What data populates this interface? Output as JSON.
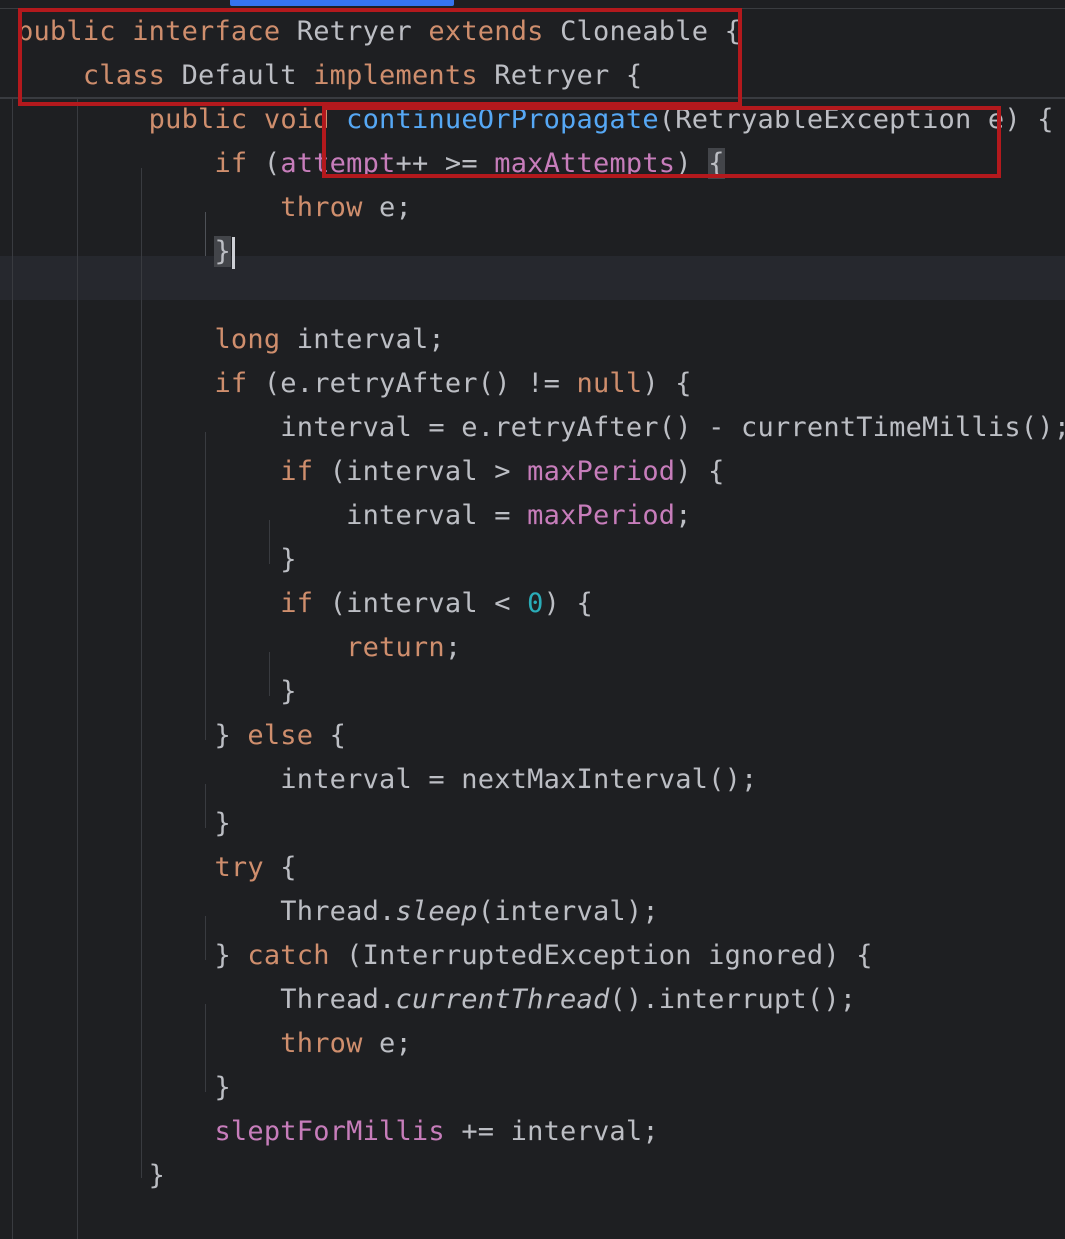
{
  "editor": {
    "language": "Java",
    "lines": [
      {
        "id": "l1",
        "text": "public interface Retryer extends Cloneable {",
        "tokens": [
          {
            "t": "public ",
            "c": "kw"
          },
          {
            "t": "interface ",
            "c": "kw"
          },
          {
            "t": "Retryer ",
            "c": ""
          },
          {
            "t": "extends ",
            "c": "kw"
          },
          {
            "t": "Cloneable {",
            "c": ""
          }
        ]
      },
      {
        "id": "l2",
        "text": "    class Default implements Retryer {",
        "tokens": [
          {
            "t": "    ",
            "c": ""
          },
          {
            "t": "class ",
            "c": "kw"
          },
          {
            "t": "Default ",
            "c": ""
          },
          {
            "t": "implements ",
            "c": "kw"
          },
          {
            "t": "Retryer {",
            "c": ""
          }
        ]
      },
      {
        "id": "l3",
        "text": "        public void continueOrPropagate(RetryableException e) {",
        "tokens": [
          {
            "t": "        ",
            "c": ""
          },
          {
            "t": "public ",
            "c": "kw"
          },
          {
            "t": "void ",
            "c": "kw"
          },
          {
            "t": "continueOrPropagate",
            "c": "fn"
          },
          {
            "t": "(RetryableException e) {",
            "c": ""
          }
        ]
      },
      {
        "id": "l4",
        "text": "            if (attempt++ >= maxAttempts) {",
        "tokens": [
          {
            "t": "            ",
            "c": ""
          },
          {
            "t": "if ",
            "c": "kw"
          },
          {
            "t": "(",
            "c": ""
          },
          {
            "t": "attempt",
            "c": "field"
          },
          {
            "t": "++ >= ",
            "c": ""
          },
          {
            "t": "maxAttempts",
            "c": "field"
          },
          {
            "t": ") ",
            "c": ""
          },
          {
            "t": "{",
            "c": "brace-match"
          }
        ]
      },
      {
        "id": "l5",
        "text": "                throw e;",
        "tokens": [
          {
            "t": "                ",
            "c": ""
          },
          {
            "t": "throw ",
            "c": "kw"
          },
          {
            "t": "e;",
            "c": ""
          }
        ]
      },
      {
        "id": "l6",
        "text": "            }",
        "tokens": [
          {
            "t": "            ",
            "c": ""
          },
          {
            "t": "}",
            "c": "brace-match"
          },
          {
            "t": "",
            "c": "caret"
          }
        ]
      },
      {
        "id": "l7",
        "text": "",
        "tokens": []
      },
      {
        "id": "l8",
        "text": "            long interval;",
        "tokens": [
          {
            "t": "            ",
            "c": ""
          },
          {
            "t": "long ",
            "c": "kw"
          },
          {
            "t": "interval;",
            "c": ""
          }
        ]
      },
      {
        "id": "l9",
        "text": "            if (e.retryAfter() != null) {",
        "tokens": [
          {
            "t": "            ",
            "c": ""
          },
          {
            "t": "if ",
            "c": "kw"
          },
          {
            "t": "(e.retryAfter() != ",
            "c": ""
          },
          {
            "t": "null",
            "c": "kw"
          },
          {
            "t": ") {",
            "c": ""
          }
        ]
      },
      {
        "id": "l10",
        "text": "                interval = e.retryAfter() - currentTimeMillis();",
        "tokens": [
          {
            "t": "                interval = e.retryAfter() - currentTimeMillis();",
            "c": ""
          }
        ]
      },
      {
        "id": "l11",
        "text": "                if (interval > maxPeriod) {",
        "tokens": [
          {
            "t": "                ",
            "c": ""
          },
          {
            "t": "if ",
            "c": "kw"
          },
          {
            "t": "(interval > ",
            "c": ""
          },
          {
            "t": "maxPeriod",
            "c": "field"
          },
          {
            "t": ") {",
            "c": ""
          }
        ]
      },
      {
        "id": "l12",
        "text": "                    interval = maxPeriod;",
        "tokens": [
          {
            "t": "                    interval = ",
            "c": ""
          },
          {
            "t": "maxPeriod",
            "c": "field"
          },
          {
            "t": ";",
            "c": ""
          }
        ]
      },
      {
        "id": "l13",
        "text": "                }",
        "tokens": [
          {
            "t": "                }",
            "c": ""
          }
        ]
      },
      {
        "id": "l14",
        "text": "                if (interval < 0) {",
        "tokens": [
          {
            "t": "                ",
            "c": ""
          },
          {
            "t": "if ",
            "c": "kw"
          },
          {
            "t": "(interval < ",
            "c": ""
          },
          {
            "t": "0",
            "c": "num"
          },
          {
            "t": ") {",
            "c": ""
          }
        ]
      },
      {
        "id": "l15",
        "text": "                    return;",
        "tokens": [
          {
            "t": "                    ",
            "c": ""
          },
          {
            "t": "return",
            "c": "kw"
          },
          {
            "t": ";",
            "c": ""
          }
        ]
      },
      {
        "id": "l16",
        "text": "                }",
        "tokens": [
          {
            "t": "                }",
            "c": ""
          }
        ]
      },
      {
        "id": "l17",
        "text": "            } else {",
        "tokens": [
          {
            "t": "            } ",
            "c": ""
          },
          {
            "t": "else ",
            "c": "kw"
          },
          {
            "t": "{",
            "c": ""
          }
        ]
      },
      {
        "id": "l18",
        "text": "                interval = nextMaxInterval();",
        "tokens": [
          {
            "t": "                interval = nextMaxInterval();",
            "c": ""
          }
        ]
      },
      {
        "id": "l19",
        "text": "            }",
        "tokens": [
          {
            "t": "            }",
            "c": ""
          }
        ]
      },
      {
        "id": "l20",
        "text": "            try {",
        "tokens": [
          {
            "t": "            ",
            "c": ""
          },
          {
            "t": "try ",
            "c": "kw"
          },
          {
            "t": "{",
            "c": ""
          }
        ]
      },
      {
        "id": "l21",
        "text": "                Thread.sleep(interval);",
        "tokens": [
          {
            "t": "                Thread.",
            "c": ""
          },
          {
            "t": "sleep",
            "c": "italic"
          },
          {
            "t": "(interval);",
            "c": ""
          }
        ]
      },
      {
        "id": "l22",
        "text": "            } catch (InterruptedException ignored) {",
        "tokens": [
          {
            "t": "            } ",
            "c": ""
          },
          {
            "t": "catch ",
            "c": "kw"
          },
          {
            "t": "(InterruptedException ignored) {",
            "c": ""
          }
        ]
      },
      {
        "id": "l23",
        "text": "                Thread.currentThread().interrupt();",
        "tokens": [
          {
            "t": "                Thread.",
            "c": ""
          },
          {
            "t": "currentThread",
            "c": "italic"
          },
          {
            "t": "().interrupt();",
            "c": ""
          }
        ]
      },
      {
        "id": "l24",
        "text": "                throw e;",
        "tokens": [
          {
            "t": "                ",
            "c": ""
          },
          {
            "t": "throw ",
            "c": "kw"
          },
          {
            "t": "e;",
            "c": ""
          }
        ]
      },
      {
        "id": "l25",
        "text": "            }",
        "tokens": [
          {
            "t": "            }",
            "c": ""
          }
        ]
      },
      {
        "id": "l26",
        "text": "            sleptForMillis += interval;",
        "tokens": [
          {
            "t": "            ",
            "c": ""
          },
          {
            "t": "sleptForMillis",
            "c": "field"
          },
          {
            "t": " += interval;",
            "c": ""
          }
        ]
      },
      {
        "id": "l27",
        "text": "        }",
        "tokens": [
          {
            "t": "        }",
            "c": ""
          }
        ]
      }
    ]
  },
  "colors": {
    "background": "#1e1f22",
    "keyword": "#cf8e6d",
    "method_declaration": "#56a8f5",
    "field": "#c77dbb",
    "number": "#2aacb8",
    "default_text": "#bcbec4",
    "annotation_box": "#b3191d"
  }
}
